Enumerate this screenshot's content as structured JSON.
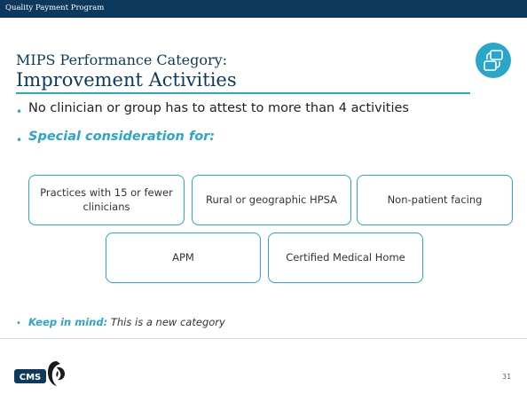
{
  "header": {
    "program": "Quality Payment Program"
  },
  "title": {
    "line1": "MIPS Performance Category:",
    "line2": "Improvement Activities",
    "icon": "cycle-arrows-icon"
  },
  "bullets": [
    {
      "text": "No clinician or group has to attest to more than 4 activities"
    },
    {
      "text": "Special consideration for:"
    }
  ],
  "boxes": [
    {
      "label": "Practices with 15 or fewer clinicians"
    },
    {
      "label": "Rural or geographic HPSA"
    },
    {
      "label": "Non-patient facing"
    },
    {
      "label": "APM"
    },
    {
      "label": "Certified Medical Home"
    }
  ],
  "note": {
    "emphasis": "Keep in mind:",
    "text": "This is a new category"
  },
  "footer": {
    "logo_cms": "CMS",
    "logo_hhs": "hhs-eagle-icon",
    "page_number": "31"
  },
  "colors": {
    "navy": "#0d3a5c",
    "teal": "#2aa6c9"
  }
}
